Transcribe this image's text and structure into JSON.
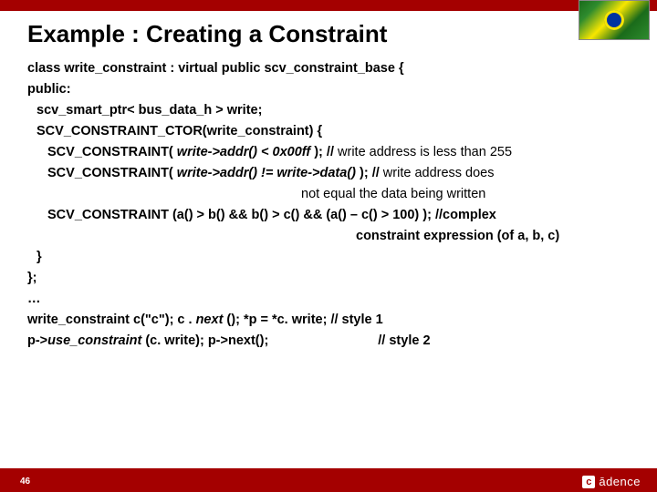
{
  "title": "Example : Creating a Constraint",
  "code": {
    "l1": "class write_constraint : virtual public scv_constraint_base {",
    "l2": "public:",
    "l3": "scv_smart_ptr< bus_data_h > write;",
    "l4": "SCV_CONSTRAINT_CTOR(write_constraint) {",
    "l5a": "SCV_CONSTRAINT( ",
    "l5b": "write->addr() < 0x00ff",
    "l5c": " ); // ",
    "l5d": "write address is less than 255",
    "l6a": "SCV_CONSTRAINT( ",
    "l6b": "write->addr() != write->data()",
    "l6c": " );  // ",
    "l6d": "write address does",
    "l6e": "not equal the data being written",
    "l7a": "SCV_CONSTRAINT ",
    "l7b": "(a() > b() && b() > c() && (a() – c() > 100)",
    "l7c": " ); //complex",
    "l7d": "constraint expression (of a, b, c)",
    "l8": "}",
    "l9": "};",
    "l10": "…",
    "l11a": "write_constraint c(\"c\"); c . ",
    "l11b": "next",
    "l11c": " (); *p = *c. write; // style 1",
    "l12a": "p->",
    "l12b": "use_constraint",
    "l12c": " (c. write); p->next();",
    "l12d": "// style 2"
  },
  "footer": {
    "page": "46",
    "logo_char": "c",
    "logo_text": "ādence"
  }
}
